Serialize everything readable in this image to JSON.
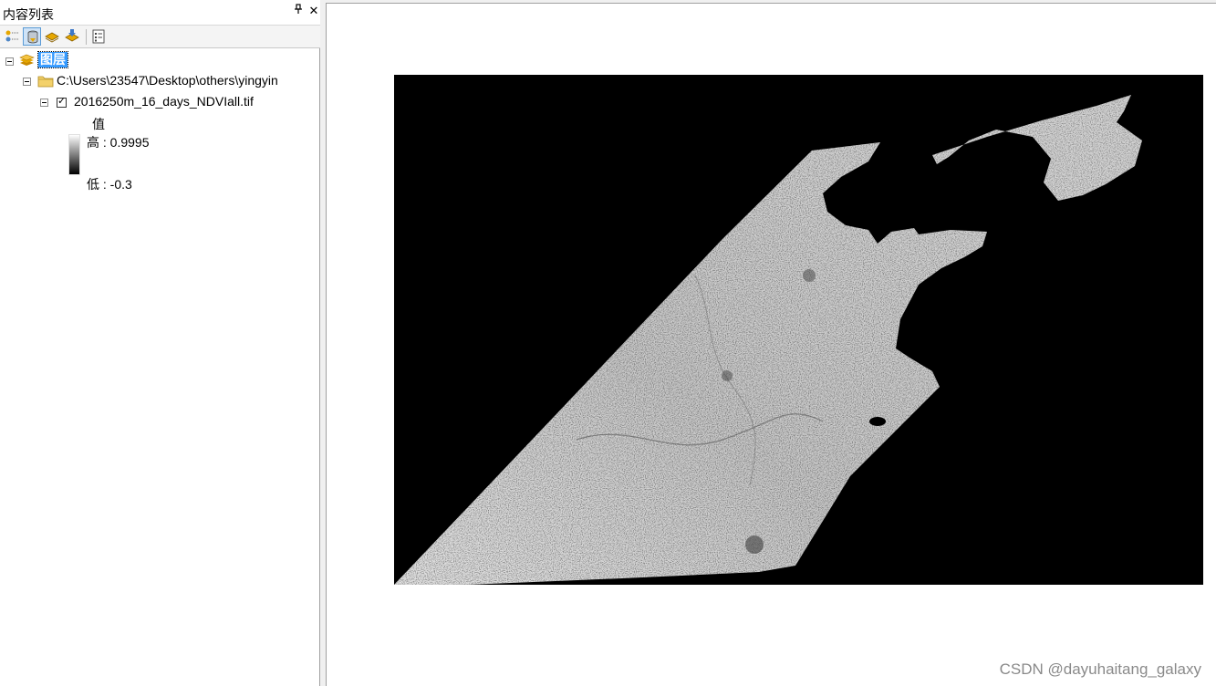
{
  "toc": {
    "title": "内容列表",
    "pin_glyph": "ᵖ",
    "close_glyph": "✕",
    "toolbar": [
      {
        "name": "list-by-drawing-order-icon"
      },
      {
        "name": "list-by-source-icon",
        "active": true
      },
      {
        "name": "list-by-visibility-icon"
      },
      {
        "name": "list-by-selection-icon"
      },
      {
        "name": "options-icon"
      }
    ],
    "tree": {
      "root_label": "图层",
      "folder_label": "C:\\Users\\23547\\Desktop\\others\\yingyin",
      "layer_label": "2016250m_16_days_NDVIall.tif",
      "layer_checked": true,
      "legend_heading": "值",
      "legend_high": "高 : 0.9995",
      "legend_low": "低 : -0.3"
    }
  },
  "map": {
    "raster_background": "#000000",
    "watermark": "CSDN @dayuhaitang_galaxy"
  },
  "colors": {
    "selection": "#3399ff",
    "panel_bg": "#ffffff",
    "chrome_bg": "#f0f0f0"
  }
}
